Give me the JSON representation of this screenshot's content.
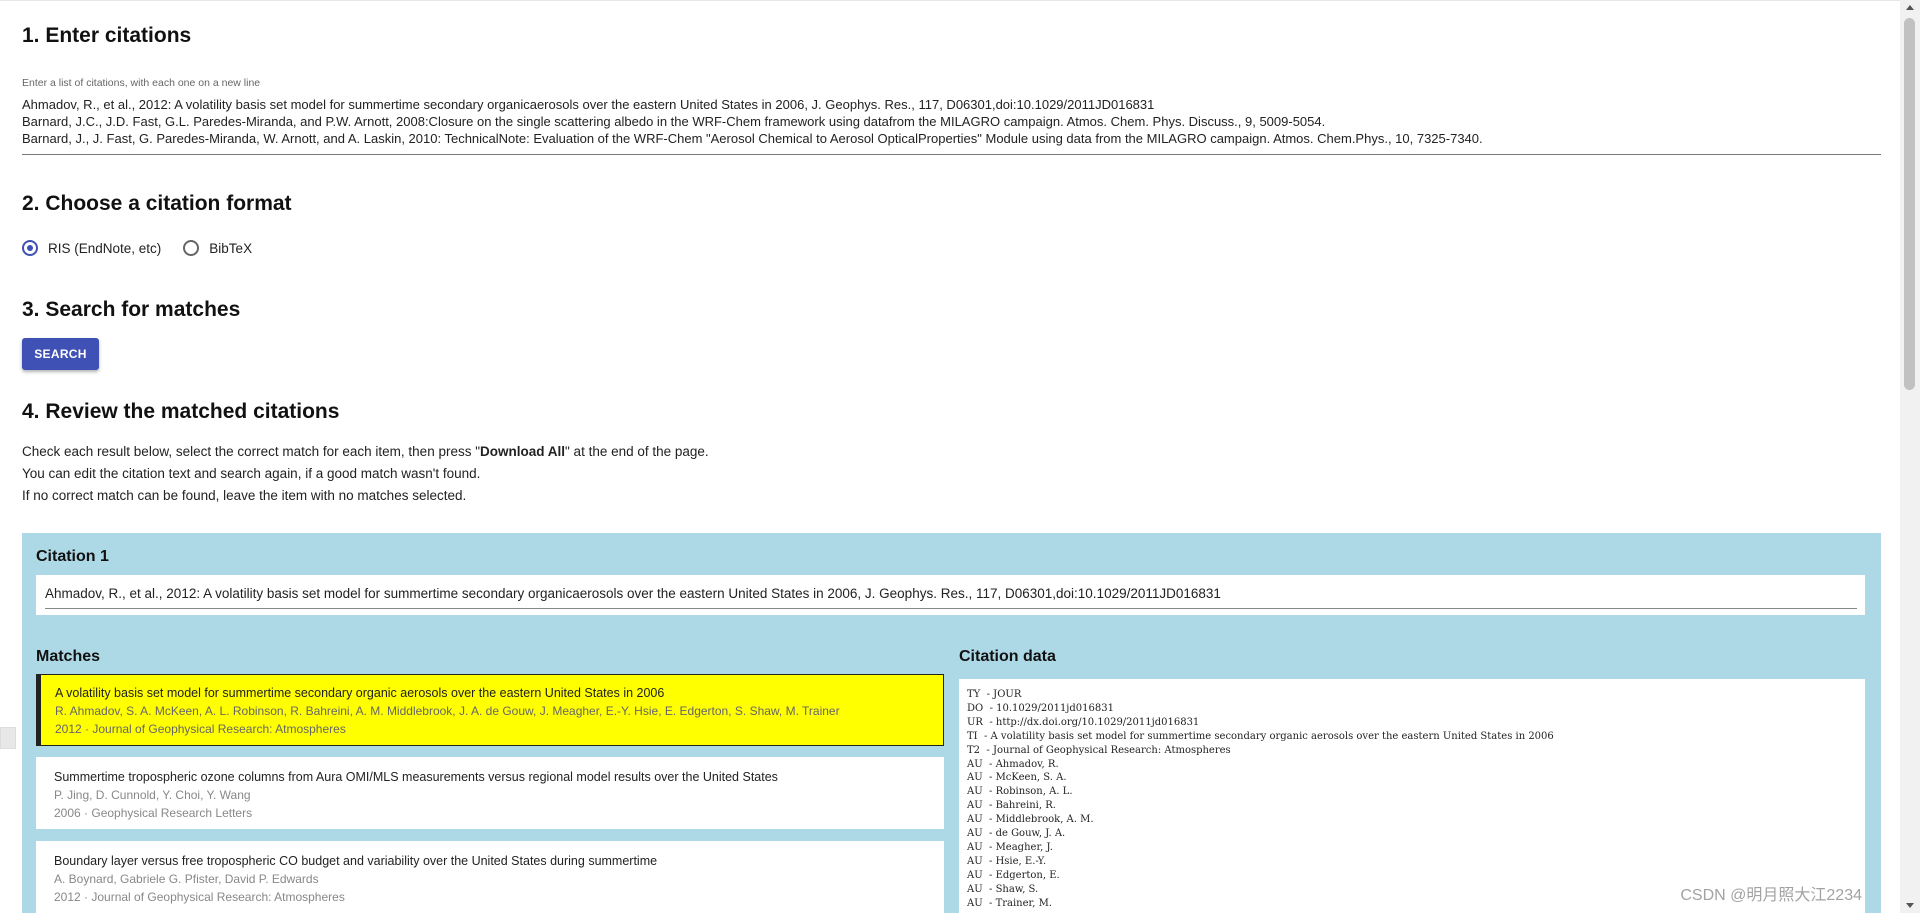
{
  "section1": {
    "title": "1. Enter citations",
    "textarea_label": "Enter a list of citations, with each one on a new line",
    "lines": [
      "Ahmadov, R., et al., 2012: A volatility basis set model for summertime secondary organicaerosols over the eastern United States in 2006, J. Geophys. Res., 117, D06301,doi:10.1029/2011JD016831",
      "Barnard, J.C., J.D. Fast, G.L. Paredes-Miranda, and P.W. Arnott, 2008:Closure on the single scattering albedo in the WRF-Chem framework using datafrom the MILAGRO campaign. Atmos. Chem. Phys. Discuss., 9, 5009-5054.",
      "Barnard, J., J. Fast, G. Paredes-Miranda, W. Arnott, and A. Laskin, 2010: TechnicalNote: Evaluation of the WRF-Chem \"Aerosol Chemical to Aerosol OpticalProperties\" Module using data from the MILAGRO campaign. Atmos. Chem.Phys., 10, 7325-7340."
    ]
  },
  "section2": {
    "title": "2. Choose a citation format",
    "options": [
      {
        "label": "RIS (EndNote, etc)",
        "selected": true
      },
      {
        "label": "BibTeX",
        "selected": false
      }
    ]
  },
  "section3": {
    "title": "3. Search for matches",
    "button": "SEARCH"
  },
  "section4": {
    "title": "4. Review the matched citations",
    "instr1_pre": "Check each result below, select the correct match for each item, then press \"",
    "instr1_bold": "Download All",
    "instr1_post": "\" at the end of the page.",
    "instr2": "You can edit the citation text and search again, if a good match wasn't found.",
    "instr3": "If no correct match can be found, leave the item with no matches selected."
  },
  "citation": {
    "title": "Citation 1",
    "text": "Ahmadov, R., et al., 2012: A volatility basis set model for summertime secondary organicaerosols over the eastern United States in 2006, J. Geophys. Res., 117, D06301,doi:10.1029/2011JD016831",
    "matches_title": "Matches",
    "data_title": "Citation data",
    "matches": [
      {
        "title": "A volatility basis set model for summertime secondary organic aerosols over the eastern United States in 2006",
        "authors": "R. Ahmadov, S. A. McKeen, A. L. Robinson, R. Bahreini, A. M. Middlebrook, J. A. de Gouw, J. Meagher, E.-Y. Hsie, E. Edgerton, S. Shaw, M. Trainer",
        "meta": "2012 · Journal of Geophysical Research: Atmospheres"
      },
      {
        "title": "Summertime tropospheric ozone columns from Aura OMI/MLS measurements versus regional model results over the United States",
        "authors": "P. Jing, D. Cunnold, Y. Choi, Y. Wang",
        "meta": "2006 · Geophysical Research Letters"
      },
      {
        "title": "Boundary layer versus free tropospheric CO budget and variability over the United States during summertime",
        "authors": "A. Boynard, Gabriele G. Pfister, David P. Edwards",
        "meta": "2012 · Journal of Geophysical Research: Atmospheres"
      }
    ],
    "ris": [
      "TY  - JOUR",
      "DO  - 10.1029/2011jd016831",
      "UR  - http://dx.doi.org/10.1029/2011jd016831",
      "TI  - A volatility basis set model for summertime secondary organic aerosols over the eastern United States in 2006",
      "T2  - Journal of Geophysical Research: Atmospheres",
      "AU  - Ahmadov, R.",
      "AU  - McKeen, S. A.",
      "AU  - Robinson, A. L.",
      "AU  - Bahreini, R.",
      "AU  - Middlebrook, A. M.",
      "AU  - de Gouw, J. A.",
      "AU  - Meagher, J.",
      "AU  - Hsie, E.-Y.",
      "AU  - Edgerton, E.",
      "AU  - Shaw, S.",
      "AU  - Trainer, M."
    ]
  },
  "watermark": "CSDN @明月照大江2234",
  "colors": {
    "primary": "#3f51b5",
    "card_bg": "#add8e6",
    "selected_bg": "#ffff00"
  }
}
